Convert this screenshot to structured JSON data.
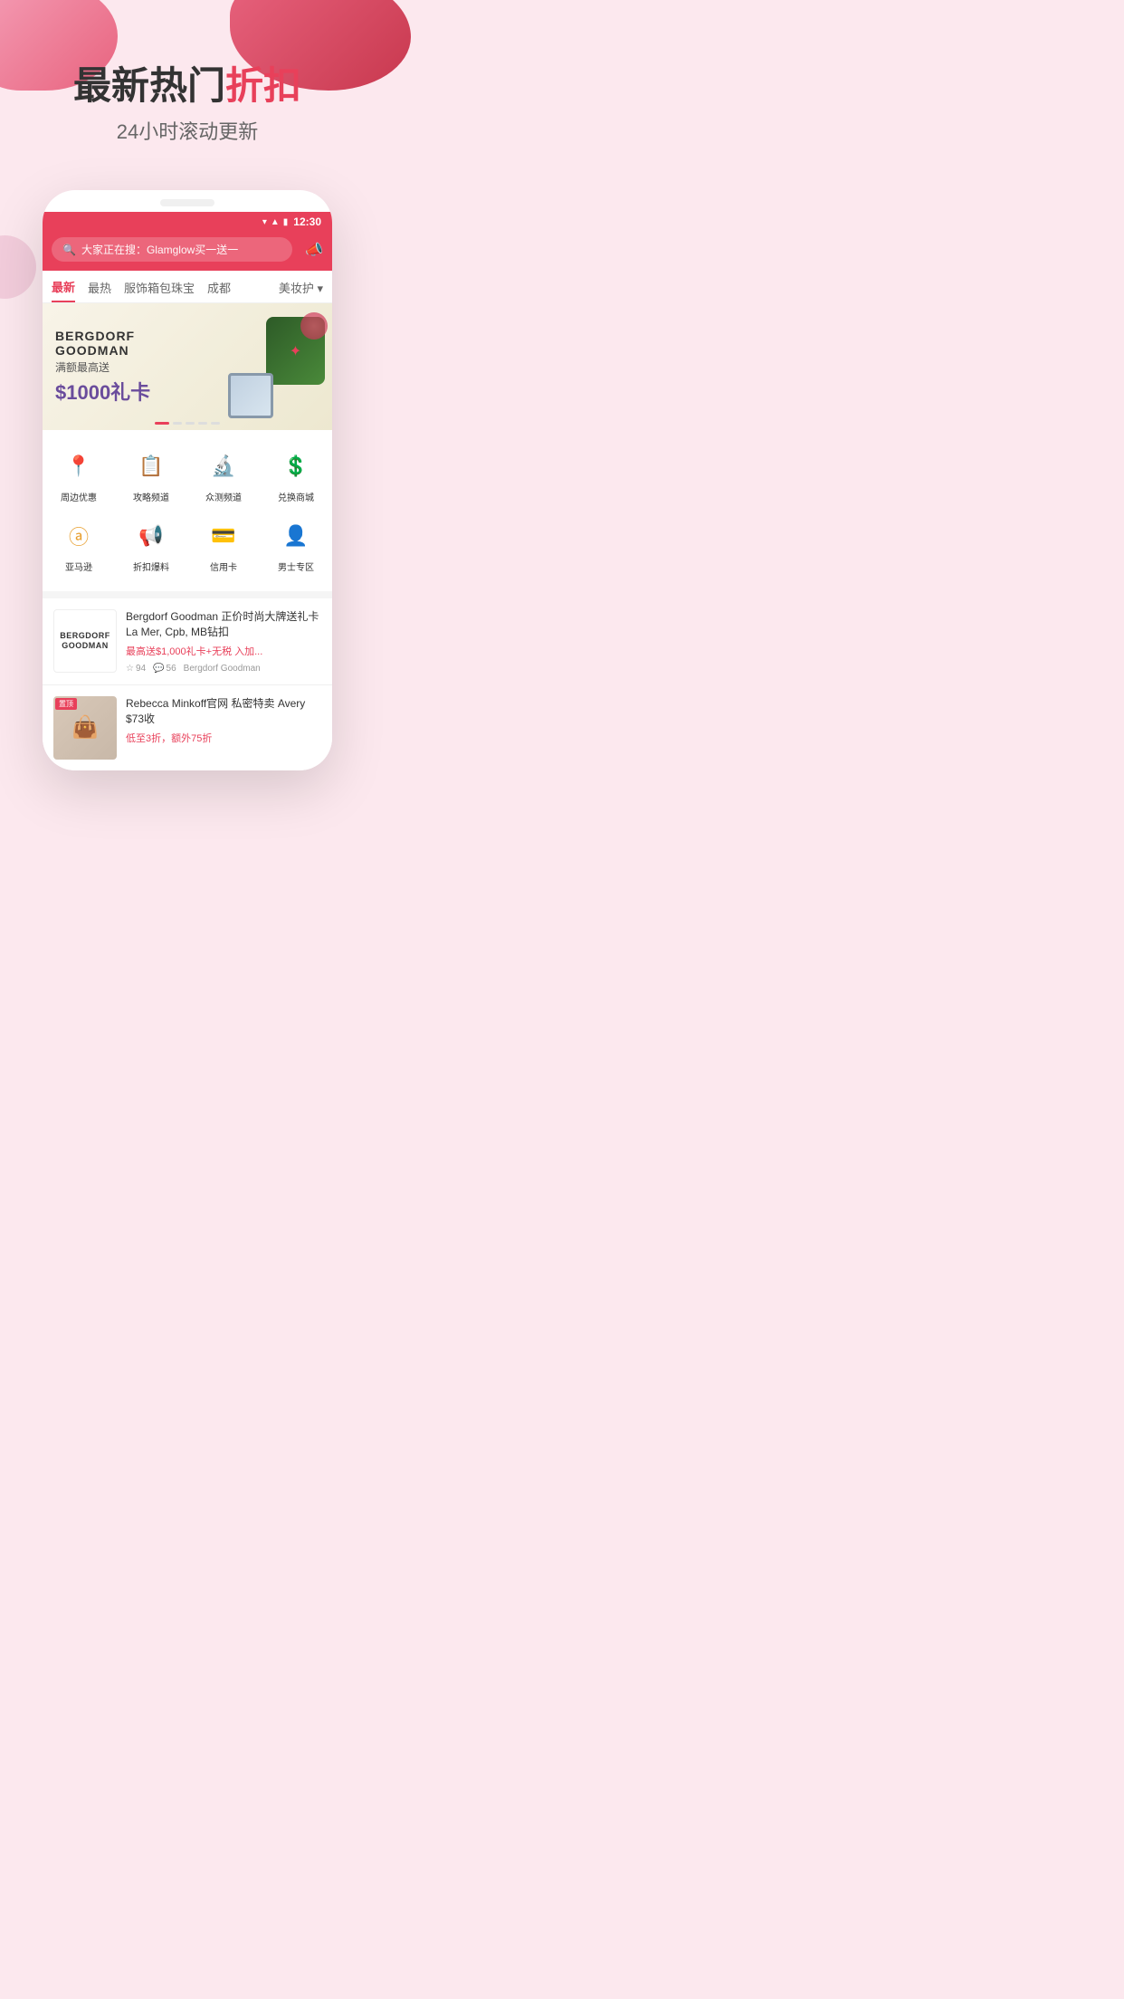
{
  "app": {
    "background_color": "#fce8ee"
  },
  "hero": {
    "title_part1": "最新热门",
    "title_part2": "折扣",
    "subtitle": "24小时滚动更新"
  },
  "phone": {
    "status_bar": {
      "time": "12:30",
      "wifi": "▼",
      "signal": "▲",
      "battery": "🔋"
    },
    "search": {
      "placeholder": "大家正在搜：Glamglow买一送一"
    },
    "nav_tabs": [
      {
        "label": "最新",
        "active": true
      },
      {
        "label": "最热",
        "active": false
      },
      {
        "label": "服饰箱包珠宝",
        "active": false
      },
      {
        "label": "成都",
        "active": false
      },
      {
        "label": "美妆护",
        "active": false
      }
    ],
    "banner": {
      "brand": "BERGDORF GOODMAN",
      "sub": "满额最高送",
      "promo": "$1000礼卡"
    },
    "quick_links": [
      {
        "label": "周边优惠",
        "icon": "📍",
        "color": "#e8a030"
      },
      {
        "label": "攻略频道",
        "icon": "📋",
        "color": "#e8405a"
      },
      {
        "label": "众测频道",
        "icon": "🔬",
        "color": "#40a8c8"
      },
      {
        "label": "兑换商城",
        "icon": "💲",
        "color": "#e8a030"
      },
      {
        "label": "亚马逊",
        "icon": "ⓐ",
        "color": "#e8a030"
      },
      {
        "label": "折扣爆料",
        "icon": "📢",
        "color": "#e8405a"
      },
      {
        "label": "信用卡",
        "icon": "💳",
        "color": "#6a4c9c"
      },
      {
        "label": "男士专区",
        "icon": "👤",
        "color": "#6a4c9c"
      }
    ],
    "deals": [
      {
        "logo": "BERGDORF\nGOODMAN",
        "title": "Bergdorf Goodman 正价时尚大牌送礼卡 La Mer, Cpb, MB钻扣",
        "promo": "最高送$1,000礼卡+无税 入加...",
        "stars": "94",
        "comments": "56",
        "source": "Bergdorf Goodman"
      },
      {
        "badge": "置顶",
        "image_desc": "bag",
        "title": "Rebecca Minkoff官网 私密特卖 Avery $73收",
        "promo": "低至3折，额外75折"
      }
    ]
  }
}
